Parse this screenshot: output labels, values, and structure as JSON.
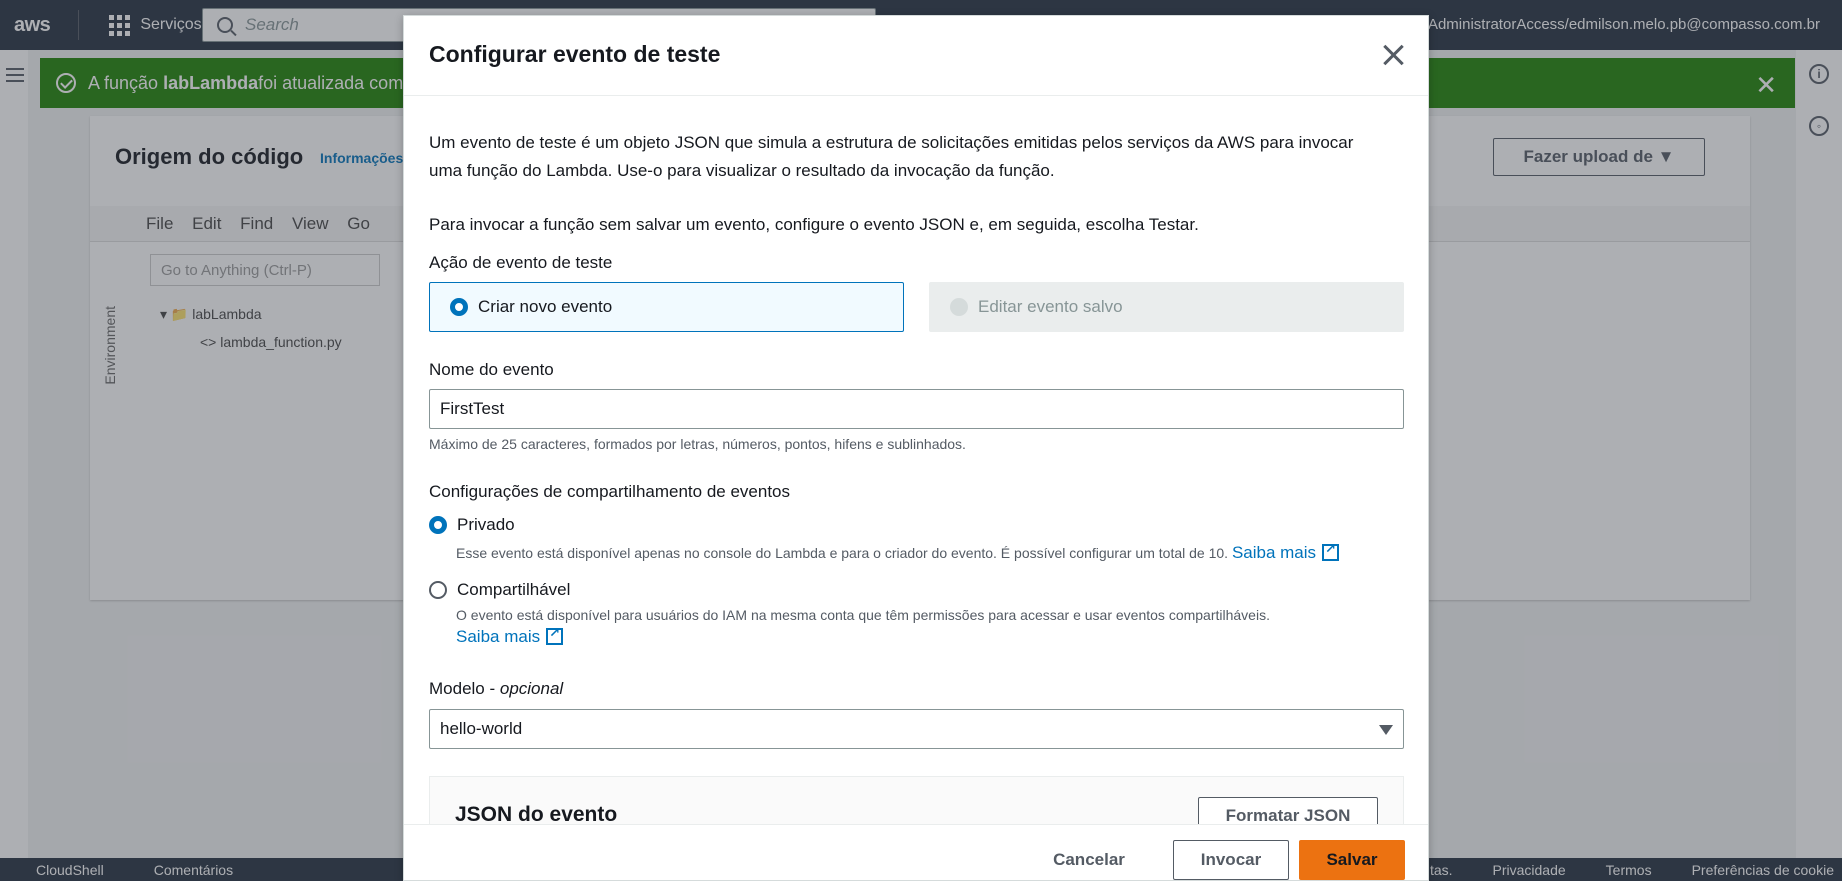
{
  "topnav": {
    "logo": "aws",
    "services_label": "Serviços",
    "search_placeholder": "Search",
    "account": "AdministratorAccess/edmilson.melo.pb@compasso.com.br"
  },
  "flash": {
    "prefix": "A função ",
    "function_name": "labLambda",
    "suffix": " foi atualizada com"
  },
  "panel": {
    "title": "Origem do código",
    "info": "Informações",
    "upload_label": "Fazer upload de",
    "ide_menu": [
      "File",
      "Edit",
      "Find",
      "View",
      "Go"
    ],
    "goto_placeholder": "Go to Anything (Ctrl-P)",
    "environment_label": "Environment",
    "folder": "labLambda",
    "file": "lambda_function.py"
  },
  "bottombar": {
    "cloudshell": "CloudShell",
    "comments": "Comentários",
    "right_links": [
      "ntas.",
      "Privacidade",
      "Termos",
      "Preferências de cookie"
    ]
  },
  "modal": {
    "title": "Configurar evento de teste",
    "intro_line1": "Um evento de teste é um objeto JSON que simula a estrutura de solicitações emitidas pelos serviços da AWS para invocar",
    "intro_line2": "uma função do Lambda. Use-o para visualizar o resultado da invocação da função.",
    "intro_para2": "Para invocar a função sem salvar um evento, configure o evento JSON e, em seguida, escolha Testar.",
    "action_label": "Ação de evento de teste",
    "action_options": [
      "Criar novo evento",
      "Editar evento salvo"
    ],
    "event_name_label": "Nome do evento",
    "event_name_value": "FirstTest",
    "event_name_hint": "Máximo de 25 caracteres, formados por letras, números, pontos, hifens e sublinhados.",
    "sharing_label": "Configurações de compartilhamento de eventos",
    "private_label": "Privado",
    "private_desc": "Esse evento está disponível apenas no console do Lambda e para o criador do evento. É possível configurar um total de 10.",
    "learn_more": "Saiba mais",
    "shareable_label": "Compartilhável",
    "shareable_desc": "O evento está disponível para usuários do IAM na mesma conta que têm permissões para acessar e usar eventos compartilháveis.",
    "template_label": "Modelo - ",
    "template_optional": "opcional",
    "template_value": "hello-world",
    "json_title": "JSON do evento",
    "format_json": "Formatar JSON",
    "cancel": "Cancelar",
    "invoke": "Invocar",
    "save": "Salvar"
  },
  "colors": {
    "accent": "#0073bb",
    "primary_button": "#ec7211",
    "nav_bg": "#232f3e",
    "success": "#1d8102"
  }
}
